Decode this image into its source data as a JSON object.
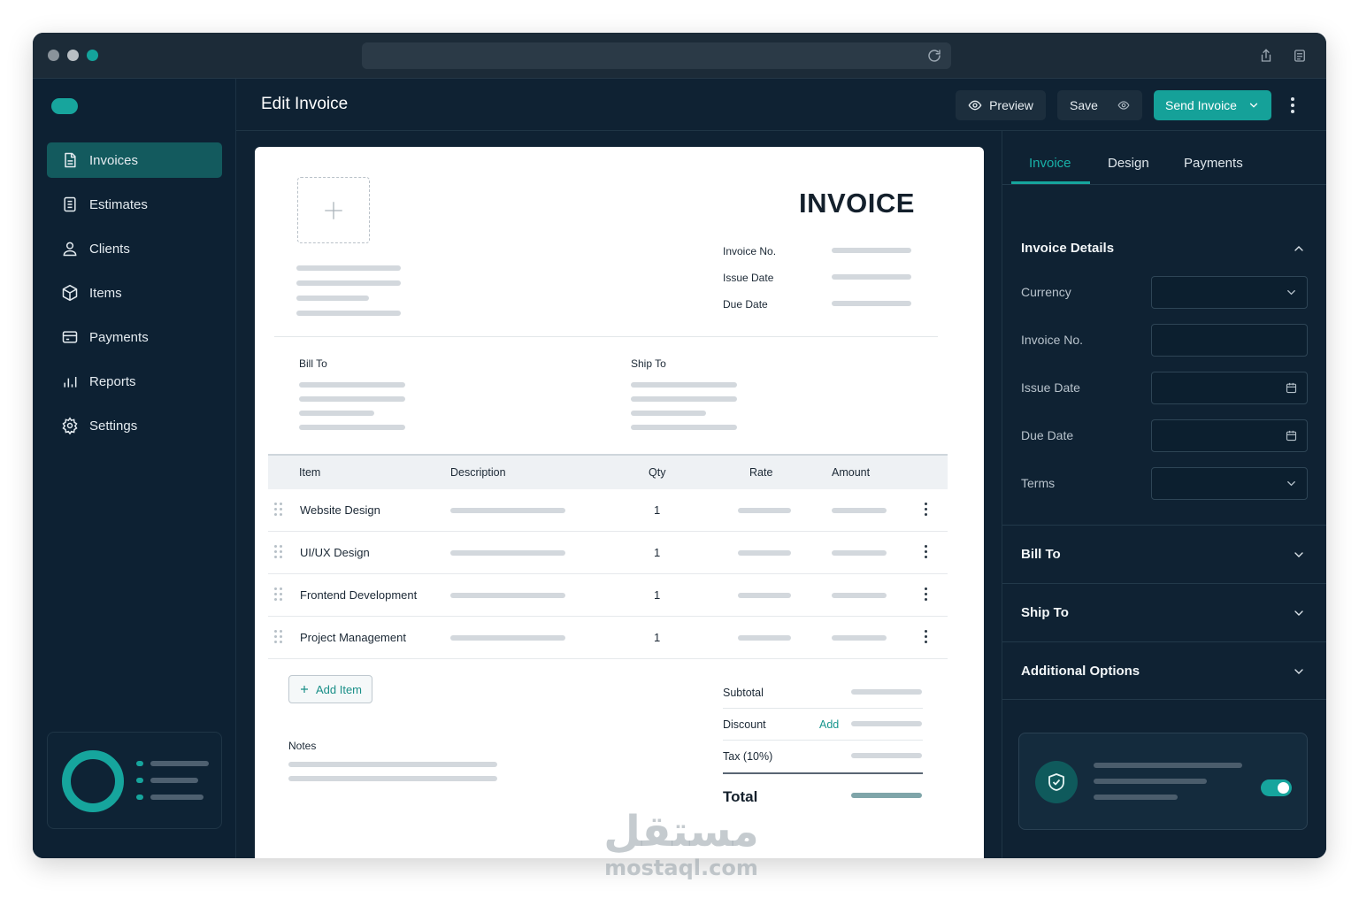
{
  "sidebar": {
    "items": [
      {
        "label": "Invoices",
        "icon": "file-icon",
        "active": true
      },
      {
        "label": "Estimates",
        "icon": "document-list-icon",
        "active": false
      },
      {
        "label": "Clients",
        "icon": "user-icon",
        "active": false
      },
      {
        "label": "Items",
        "icon": "box-icon",
        "active": false
      },
      {
        "label": "Payments",
        "icon": "credit-card-icon",
        "active": false
      },
      {
        "label": "Reports",
        "icon": "bar-chart-icon",
        "active": false
      },
      {
        "label": "Settings",
        "icon": "gear-icon",
        "active": false
      }
    ]
  },
  "header": {
    "title": "Edit Invoice",
    "preview_label": "Preview",
    "save_label": "Save",
    "send_label": "Send Invoice"
  },
  "invoice": {
    "heading": "INVOICE",
    "meta_labels": {
      "number": "Invoice No.",
      "issue": "Issue Date",
      "due": "Due Date"
    },
    "bill_to_label": "Bill To",
    "ship_to_label": "Ship To",
    "table": {
      "columns": {
        "item": "Item",
        "description": "Description",
        "qty": "Qty",
        "rate": "Rate",
        "amount": "Amount"
      },
      "rows": [
        {
          "name": "Website Design",
          "qty": "1"
        },
        {
          "name": "UI/UX Design",
          "qty": "1"
        },
        {
          "name": "Frontend Development",
          "qty": "1"
        },
        {
          "name": "Project Management",
          "qty": "1"
        }
      ]
    },
    "add_item_label": "Add Item",
    "notes_label": "Notes",
    "subtotal_label": "Subtotal",
    "discount_label": "Discount",
    "discount_add_label": "Add",
    "tax_label": "Tax (10%)",
    "total_label": "Total"
  },
  "panel": {
    "tabs": [
      {
        "label": "Invoice",
        "active": true
      },
      {
        "label": "Design",
        "active": false
      },
      {
        "label": "Payments",
        "active": false
      }
    ],
    "details_title": "Invoice Details",
    "fields": {
      "currency": "Currency",
      "invoice_no": "Invoice No.",
      "issue_date": "Issue Date",
      "due_date": "Due Date",
      "terms": "Terms"
    },
    "sections": {
      "bill_to": "Bill To",
      "ship_to": "Ship To",
      "additional": "Additional Options"
    },
    "security_toggle_on": true
  },
  "watermark": {
    "arabic": "مستقل",
    "latin": "mostaql.com"
  },
  "colors": {
    "accent": "#16a59d",
    "window_bg": "#0f2233",
    "sidebar_active": "#135a5e",
    "paper": "#ffffff"
  }
}
